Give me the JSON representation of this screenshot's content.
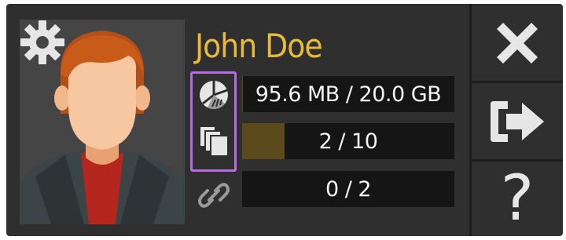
{
  "user": {
    "name": "John Doe"
  },
  "stats": [
    {
      "icon": "pie-chart-icon",
      "label": "95.6 MB / 20.0 GB",
      "fill_fraction": 0.005
    },
    {
      "icon": "pages-icon",
      "label": "2 / 10",
      "fill_fraction": 0.2
    },
    {
      "icon": "link-icon",
      "label": "0 / 2",
      "fill_fraction": 0.0
    }
  ],
  "actions": [
    {
      "icon": "close-icon"
    },
    {
      "icon": "logout-icon"
    },
    {
      "icon": "help-icon",
      "text": "?"
    }
  ],
  "colors": {
    "panel": "#2f2f2f",
    "name": "#e8ba3c",
    "highlight": "#b769e6",
    "stat_bg": "#151515",
    "stat_fill": "#5a4a1c",
    "icon": "#e6e6e6"
  }
}
